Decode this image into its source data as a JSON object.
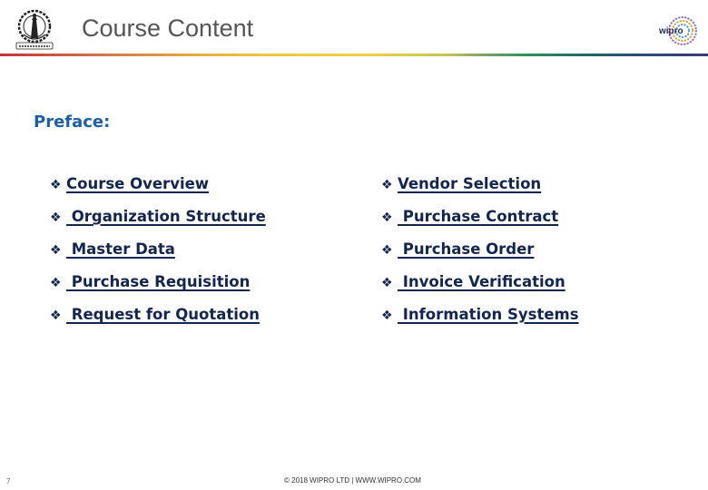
{
  "header": {
    "title": "Course Content",
    "left_logo": "institute-emblem",
    "right_logo_text": "wipro",
    "accent_gradient": [
      "#c0343c",
      "#e3a542",
      "#ecc843",
      "#2e8b57",
      "#3a3c70"
    ]
  },
  "preface": {
    "label": "Preface:",
    "color": "#1b5fa6"
  },
  "bullet_glyph": "❖",
  "topics": {
    "left": [
      {
        "label": "Course Overview"
      },
      {
        "label": " Organization Structure"
      },
      {
        "label": " Master Data"
      },
      {
        "label": " Purchase Requisition"
      },
      {
        "label": " Request for Quotation"
      }
    ],
    "right": [
      {
        "label": "Vendor Selection"
      },
      {
        "label": " Purchase Contract"
      },
      {
        "label": " Purchase Order"
      },
      {
        "label": " Invoice Verification"
      },
      {
        "label": " Information Systems"
      }
    ],
    "link_color": "#14264f"
  },
  "footer": {
    "page_number": "7",
    "copyright": "© 2018 WIPRO LTD | WWW.WIPRO.COM"
  }
}
